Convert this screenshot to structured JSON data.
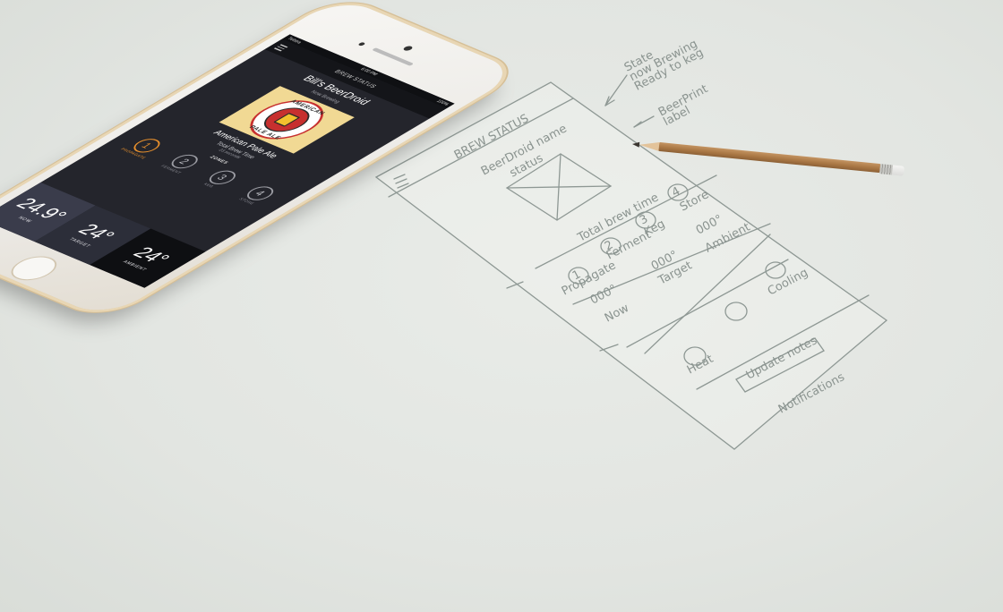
{
  "phone": {
    "status": {
      "carrier": "Telstra",
      "time": "6:00 PM",
      "battery": "100%"
    },
    "nav": {
      "title": "BREW STATUS"
    },
    "brewer_name": "Bill's BeerDroid",
    "brewer_status": "Now Brewing",
    "label": {
      "top_text": "AMERICAN",
      "bottom_text": "PALE ALE"
    },
    "beer_name": "American Pale Ale",
    "brew_time_label": "Total Brew Time",
    "brew_time_value": "23 seconds",
    "zones_title": "ZONES",
    "zones": [
      {
        "number": "1",
        "label": "PROPAGATE",
        "active": true
      },
      {
        "number": "2",
        "label": "FERMENT",
        "active": false
      },
      {
        "number": "3",
        "label": "KEG",
        "active": false
      },
      {
        "number": "4",
        "label": "STORE",
        "active": false
      }
    ],
    "temps": [
      {
        "value": "24.9°",
        "label": "NOW"
      },
      {
        "value": "24°",
        "label": "TARGET"
      },
      {
        "value": "24°",
        "label": "AMBIENT"
      }
    ],
    "accent_color": "#e8902c"
  },
  "sketch": {
    "title": "BREW STATUS",
    "name": "BeerDroid name",
    "status": "status",
    "total_brew_time": "Total brew time",
    "zone_numbers": [
      "1",
      "2",
      "3",
      "4"
    ],
    "zone_labels": [
      "Propagate",
      "Ferment",
      "Keg",
      "Store"
    ],
    "temp_readings": [
      "000°",
      "000°",
      "000°"
    ],
    "temp_labels": [
      "Now",
      "Target",
      "Ambient"
    ],
    "notes": {
      "state": "State\nnow Brewing\nReady to keg",
      "label": "BeerPrint\nlabel"
    },
    "controls": [
      "Cooling",
      "Heat",
      "Update notes"
    ],
    "notifications": "Notifications"
  }
}
